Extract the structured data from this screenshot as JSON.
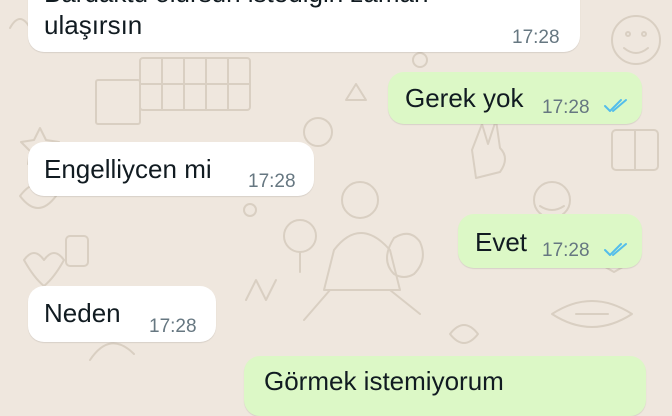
{
  "chat": {
    "messages": [
      {
        "direction": "incoming",
        "text_line1": "Bardaktu olursun istediğin zaman",
        "text_line2": "ulaşırsın",
        "time": "17:28"
      },
      {
        "direction": "outgoing",
        "text": "Gerek yok",
        "time": "17:28",
        "status": "read"
      },
      {
        "direction": "incoming",
        "text": "Engelliycen mi",
        "time": "17:28"
      },
      {
        "direction": "outgoing",
        "text": "Evet",
        "time": "17:28",
        "status": "read"
      },
      {
        "direction": "incoming",
        "text": "Neden",
        "time": "17:28"
      },
      {
        "direction": "outgoing",
        "text": "Görmek istemiyorum",
        "time": "",
        "status": ""
      }
    ]
  },
  "colors": {
    "wallpaper": "#EFE7DE",
    "incoming_bubble": "#FFFFFF",
    "outgoing_bubble": "#DCF8C6",
    "read_ticks": "#53BDEB",
    "timestamp": "#667781"
  },
  "icons": {
    "read_receipt": "double-check-icon",
    "wallpaper": "doodle-pattern"
  }
}
